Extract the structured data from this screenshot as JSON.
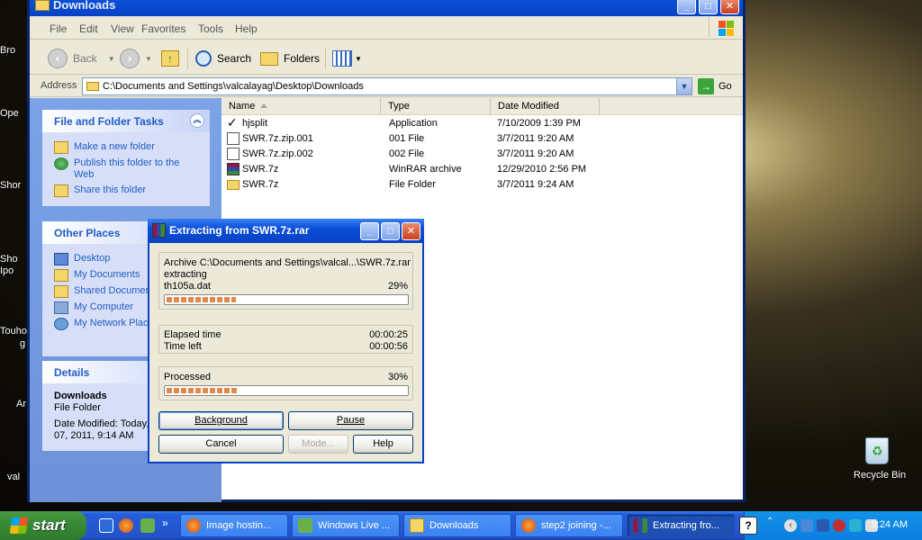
{
  "desktop": {
    "left_labels": [
      "Bro",
      "Ope",
      "Shor",
      "Sho",
      "Ipo",
      "Touho",
      "g",
      "Ar",
      "val"
    ],
    "recycle_bin": "Recycle Bin"
  },
  "explorer": {
    "title": "Downloads",
    "menu": [
      "File",
      "Edit",
      "View",
      "Favorites",
      "Tools",
      "Help"
    ],
    "toolbar": {
      "back": "Back",
      "search": "Search",
      "folders": "Folders"
    },
    "address_label": "Address",
    "address_value": "C:\\Documents and Settings\\valcalayag\\Desktop\\Downloads",
    "go_label": "Go",
    "tasks": {
      "file_folder": {
        "title": "File and Folder Tasks",
        "items": [
          "Make a new folder",
          "Publish this folder to the Web",
          "Share this folder"
        ]
      },
      "other_places": {
        "title": "Other Places",
        "items": [
          "Desktop",
          "My Documents",
          "Shared Documents",
          "My Computer",
          "My Network Places"
        ]
      },
      "details": {
        "title": "Details",
        "name": "Downloads",
        "type": "File Folder",
        "modified_line1": "Date Modified: Today, March",
        "modified_line2": "07, 2011, 9:14 AM"
      }
    },
    "columns": [
      "Name",
      "Type",
      "Date Modified"
    ],
    "files": [
      {
        "name": "hjsplit",
        "type": "Application",
        "date": "7/10/2009 1:39 PM",
        "icon": "checkmark-icon"
      },
      {
        "name": "SWR.7z.zip.001",
        "type": "001 File",
        "date": "3/7/2011 9:20 AM",
        "icon": "generic-file-icon"
      },
      {
        "name": "SWR.7z.zip.002",
        "type": "002 File",
        "date": "3/7/2011 9:20 AM",
        "icon": "generic-file-icon"
      },
      {
        "name": "SWR.7z",
        "type": "WinRAR archive",
        "date": "12/29/2010 2:56 PM",
        "icon": "winrar-icon"
      },
      {
        "name": "SWR.7z",
        "type": "File Folder",
        "date": "3/7/2011 9:24 AM",
        "icon": "folder-icon"
      }
    ]
  },
  "extract_dialog": {
    "title": "Extracting from SWR.7z.rar",
    "archive_line": "Archive C:\\Documents and Settings\\valcal...\\SWR.7z.rar",
    "action": "extracting",
    "current_file": "th105a.dat",
    "file_percent": "29%",
    "file_progress": 0.29,
    "elapsed_label": "Elapsed time",
    "elapsed_value": "00:00:25",
    "left_label": "Time left",
    "left_value": "00:00:56",
    "processed_label": "Processed",
    "processed_percent": "30%",
    "processed_progress": 0.3,
    "buttons": {
      "background": "Background",
      "pause": "Pause",
      "cancel": "Cancel",
      "mode": "Mode...",
      "help": "Help"
    }
  },
  "taskbar": {
    "start": "start",
    "tasks": [
      "Image hostin...",
      "Windows Live ...",
      "Downloads",
      "step2 joining -...",
      "Extracting fro..."
    ],
    "clock": "9:24 AM"
  },
  "colors": {
    "xp_blue": "#0a4fd8",
    "start_green": "#3c8f3a",
    "progress_orange": "#e08a4a",
    "link_blue": "#215dc6"
  }
}
